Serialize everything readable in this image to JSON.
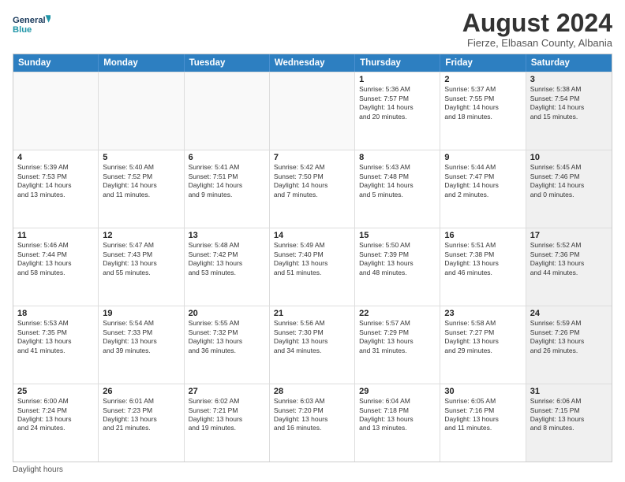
{
  "logo": {
    "line1": "General",
    "line2": "Blue"
  },
  "title": "August 2024",
  "subtitle": "Fierze, Elbasan County, Albania",
  "days": [
    "Sunday",
    "Monday",
    "Tuesday",
    "Wednesday",
    "Thursday",
    "Friday",
    "Saturday"
  ],
  "footer": "Daylight hours",
  "weeks": [
    [
      {
        "num": "",
        "empty": true
      },
      {
        "num": "",
        "empty": true
      },
      {
        "num": "",
        "empty": true
      },
      {
        "num": "",
        "empty": true
      },
      {
        "num": "1",
        "lines": [
          "Sunrise: 5:36 AM",
          "Sunset: 7:57 PM",
          "Daylight: 14 hours",
          "and 20 minutes."
        ]
      },
      {
        "num": "2",
        "lines": [
          "Sunrise: 5:37 AM",
          "Sunset: 7:55 PM",
          "Daylight: 14 hours",
          "and 18 minutes."
        ]
      },
      {
        "num": "3",
        "shaded": true,
        "lines": [
          "Sunrise: 5:38 AM",
          "Sunset: 7:54 PM",
          "Daylight: 14 hours",
          "and 15 minutes."
        ]
      }
    ],
    [
      {
        "num": "4",
        "lines": [
          "Sunrise: 5:39 AM",
          "Sunset: 7:53 PM",
          "Daylight: 14 hours",
          "and 13 minutes."
        ]
      },
      {
        "num": "5",
        "lines": [
          "Sunrise: 5:40 AM",
          "Sunset: 7:52 PM",
          "Daylight: 14 hours",
          "and 11 minutes."
        ]
      },
      {
        "num": "6",
        "lines": [
          "Sunrise: 5:41 AM",
          "Sunset: 7:51 PM",
          "Daylight: 14 hours",
          "and 9 minutes."
        ]
      },
      {
        "num": "7",
        "lines": [
          "Sunrise: 5:42 AM",
          "Sunset: 7:50 PM",
          "Daylight: 14 hours",
          "and 7 minutes."
        ]
      },
      {
        "num": "8",
        "lines": [
          "Sunrise: 5:43 AM",
          "Sunset: 7:48 PM",
          "Daylight: 14 hours",
          "and 5 minutes."
        ]
      },
      {
        "num": "9",
        "lines": [
          "Sunrise: 5:44 AM",
          "Sunset: 7:47 PM",
          "Daylight: 14 hours",
          "and 2 minutes."
        ]
      },
      {
        "num": "10",
        "shaded": true,
        "lines": [
          "Sunrise: 5:45 AM",
          "Sunset: 7:46 PM",
          "Daylight: 14 hours",
          "and 0 minutes."
        ]
      }
    ],
    [
      {
        "num": "11",
        "lines": [
          "Sunrise: 5:46 AM",
          "Sunset: 7:44 PM",
          "Daylight: 13 hours",
          "and 58 minutes."
        ]
      },
      {
        "num": "12",
        "lines": [
          "Sunrise: 5:47 AM",
          "Sunset: 7:43 PM",
          "Daylight: 13 hours",
          "and 55 minutes."
        ]
      },
      {
        "num": "13",
        "lines": [
          "Sunrise: 5:48 AM",
          "Sunset: 7:42 PM",
          "Daylight: 13 hours",
          "and 53 minutes."
        ]
      },
      {
        "num": "14",
        "lines": [
          "Sunrise: 5:49 AM",
          "Sunset: 7:40 PM",
          "Daylight: 13 hours",
          "and 51 minutes."
        ]
      },
      {
        "num": "15",
        "lines": [
          "Sunrise: 5:50 AM",
          "Sunset: 7:39 PM",
          "Daylight: 13 hours",
          "and 48 minutes."
        ]
      },
      {
        "num": "16",
        "lines": [
          "Sunrise: 5:51 AM",
          "Sunset: 7:38 PM",
          "Daylight: 13 hours",
          "and 46 minutes."
        ]
      },
      {
        "num": "17",
        "shaded": true,
        "lines": [
          "Sunrise: 5:52 AM",
          "Sunset: 7:36 PM",
          "Daylight: 13 hours",
          "and 44 minutes."
        ]
      }
    ],
    [
      {
        "num": "18",
        "lines": [
          "Sunrise: 5:53 AM",
          "Sunset: 7:35 PM",
          "Daylight: 13 hours",
          "and 41 minutes."
        ]
      },
      {
        "num": "19",
        "lines": [
          "Sunrise: 5:54 AM",
          "Sunset: 7:33 PM",
          "Daylight: 13 hours",
          "and 39 minutes."
        ]
      },
      {
        "num": "20",
        "lines": [
          "Sunrise: 5:55 AM",
          "Sunset: 7:32 PM",
          "Daylight: 13 hours",
          "and 36 minutes."
        ]
      },
      {
        "num": "21",
        "lines": [
          "Sunrise: 5:56 AM",
          "Sunset: 7:30 PM",
          "Daylight: 13 hours",
          "and 34 minutes."
        ]
      },
      {
        "num": "22",
        "lines": [
          "Sunrise: 5:57 AM",
          "Sunset: 7:29 PM",
          "Daylight: 13 hours",
          "and 31 minutes."
        ]
      },
      {
        "num": "23",
        "lines": [
          "Sunrise: 5:58 AM",
          "Sunset: 7:27 PM",
          "Daylight: 13 hours",
          "and 29 minutes."
        ]
      },
      {
        "num": "24",
        "shaded": true,
        "lines": [
          "Sunrise: 5:59 AM",
          "Sunset: 7:26 PM",
          "Daylight: 13 hours",
          "and 26 minutes."
        ]
      }
    ],
    [
      {
        "num": "25",
        "lines": [
          "Sunrise: 6:00 AM",
          "Sunset: 7:24 PM",
          "Daylight: 13 hours",
          "and 24 minutes."
        ]
      },
      {
        "num": "26",
        "lines": [
          "Sunrise: 6:01 AM",
          "Sunset: 7:23 PM",
          "Daylight: 13 hours",
          "and 21 minutes."
        ]
      },
      {
        "num": "27",
        "lines": [
          "Sunrise: 6:02 AM",
          "Sunset: 7:21 PM",
          "Daylight: 13 hours",
          "and 19 minutes."
        ]
      },
      {
        "num": "28",
        "lines": [
          "Sunrise: 6:03 AM",
          "Sunset: 7:20 PM",
          "Daylight: 13 hours",
          "and 16 minutes."
        ]
      },
      {
        "num": "29",
        "lines": [
          "Sunrise: 6:04 AM",
          "Sunset: 7:18 PM",
          "Daylight: 13 hours",
          "and 13 minutes."
        ]
      },
      {
        "num": "30",
        "lines": [
          "Sunrise: 6:05 AM",
          "Sunset: 7:16 PM",
          "Daylight: 13 hours",
          "and 11 minutes."
        ]
      },
      {
        "num": "31",
        "shaded": true,
        "lines": [
          "Sunrise: 6:06 AM",
          "Sunset: 7:15 PM",
          "Daylight: 13 hours",
          "and 8 minutes."
        ]
      }
    ]
  ]
}
